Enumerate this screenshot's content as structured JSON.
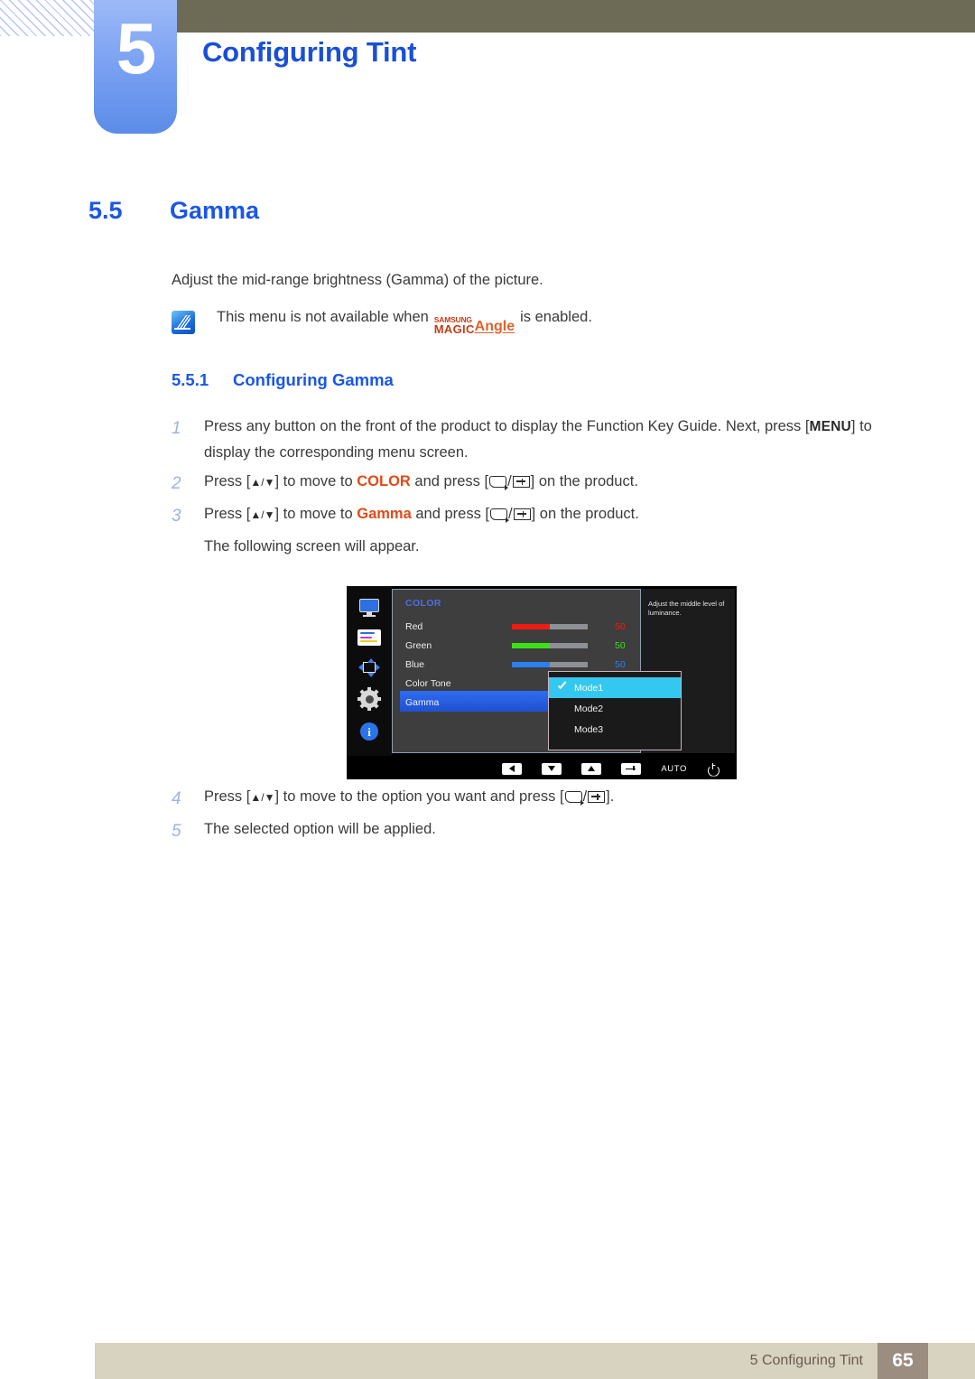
{
  "header": {
    "chapter_number": "5",
    "chapter_title": "Configuring Tint"
  },
  "section": {
    "number": "5.5",
    "title": "Gamma",
    "intro": "Adjust the mid-range brightness (Gamma) of the picture."
  },
  "note": {
    "icon": "note-quill-icon",
    "text_before": "This menu is not available when",
    "logo": {
      "samsung": "SAMSUNG",
      "magic": "MAGIC",
      "angle": "Angle"
    },
    "text_after": "is enabled."
  },
  "subsection": {
    "number": "5.5.1",
    "title": "Configuring Gamma"
  },
  "steps": [
    {
      "num": "1",
      "parts": [
        {
          "t": "text",
          "v": "Press any button on the front of the product to display the Function Key Guide. Next, press ["
        },
        {
          "t": "menu",
          "v": "MENU"
        },
        {
          "t": "text",
          "v": "] to display the corresponding menu screen."
        }
      ]
    },
    {
      "num": "2",
      "parts": [
        {
          "t": "text",
          "v": "Press ["
        },
        {
          "t": "arrows",
          "v": "▲/▼"
        },
        {
          "t": "text",
          "v": "] to move to "
        },
        {
          "t": "kw",
          "v": "COLOR"
        },
        {
          "t": "text",
          "v": " and press ["
        },
        {
          "t": "glyph",
          "v": "back"
        },
        {
          "t": "text",
          "v": "/"
        },
        {
          "t": "glyph",
          "v": "enter"
        },
        {
          "t": "text",
          "v": "] on the product."
        }
      ]
    },
    {
      "num": "3",
      "parts": [
        {
          "t": "text",
          "v": "Press ["
        },
        {
          "t": "arrows",
          "v": "▲/▼"
        },
        {
          "t": "text",
          "v": "] to move to "
        },
        {
          "t": "kw",
          "v": "Gamma"
        },
        {
          "t": "text",
          "v": " and press ["
        },
        {
          "t": "glyph",
          "v": "back"
        },
        {
          "t": "text",
          "v": "/"
        },
        {
          "t": "glyph",
          "v": "enter"
        },
        {
          "t": "text",
          "v": "] on the product."
        }
      ],
      "continuation": "The following screen will appear."
    },
    {
      "num": "4",
      "parts": [
        {
          "t": "text",
          "v": "Press ["
        },
        {
          "t": "arrows",
          "v": "▲/▼"
        },
        {
          "t": "text",
          "v": "] to move to the option you want and press ["
        },
        {
          "t": "glyph",
          "v": "back"
        },
        {
          "t": "text",
          "v": "/"
        },
        {
          "t": "glyph",
          "v": "enter"
        },
        {
          "t": "text",
          "v": "]."
        }
      ]
    },
    {
      "num": "5",
      "parts": [
        {
          "t": "text",
          "v": "The selected option will be applied."
        }
      ]
    }
  ],
  "osd": {
    "sidebar_icons": [
      "monitor-icon",
      "picture-sliders-icon",
      "screen-adjust-icon",
      "gear-icon",
      "info-icon"
    ],
    "menu_title": "COLOR",
    "rows": [
      {
        "label": "Red",
        "value": "50",
        "fill_pct": 50,
        "color": "#ee1c12"
      },
      {
        "label": "Green",
        "value": "50",
        "fill_pct": 50,
        "color": "#3ce018"
      },
      {
        "label": "Blue",
        "value": "50",
        "fill_pct": 50,
        "color": "#2b7ff0"
      },
      {
        "label": "Color Tone",
        "value": "",
        "fill_pct": 0,
        "color": ""
      },
      {
        "label": "Gamma",
        "value": "",
        "fill_pct": 0,
        "color": ""
      }
    ],
    "selected_row": "Gamma",
    "dropdown": {
      "items": [
        "Mode1",
        "Mode2",
        "Mode3"
      ],
      "selected": "Mode1",
      "highlight_color": "#34c8f0"
    },
    "tooltip": "Adjust the middle level of luminance.",
    "keys": [
      "left-arrow-key",
      "down-arrow-key",
      "up-arrow-key",
      "enter-key",
      "AUTO",
      "power-key"
    ],
    "auto_label": "AUTO"
  },
  "footer": {
    "label": "5 Configuring Tint",
    "page": "65"
  }
}
